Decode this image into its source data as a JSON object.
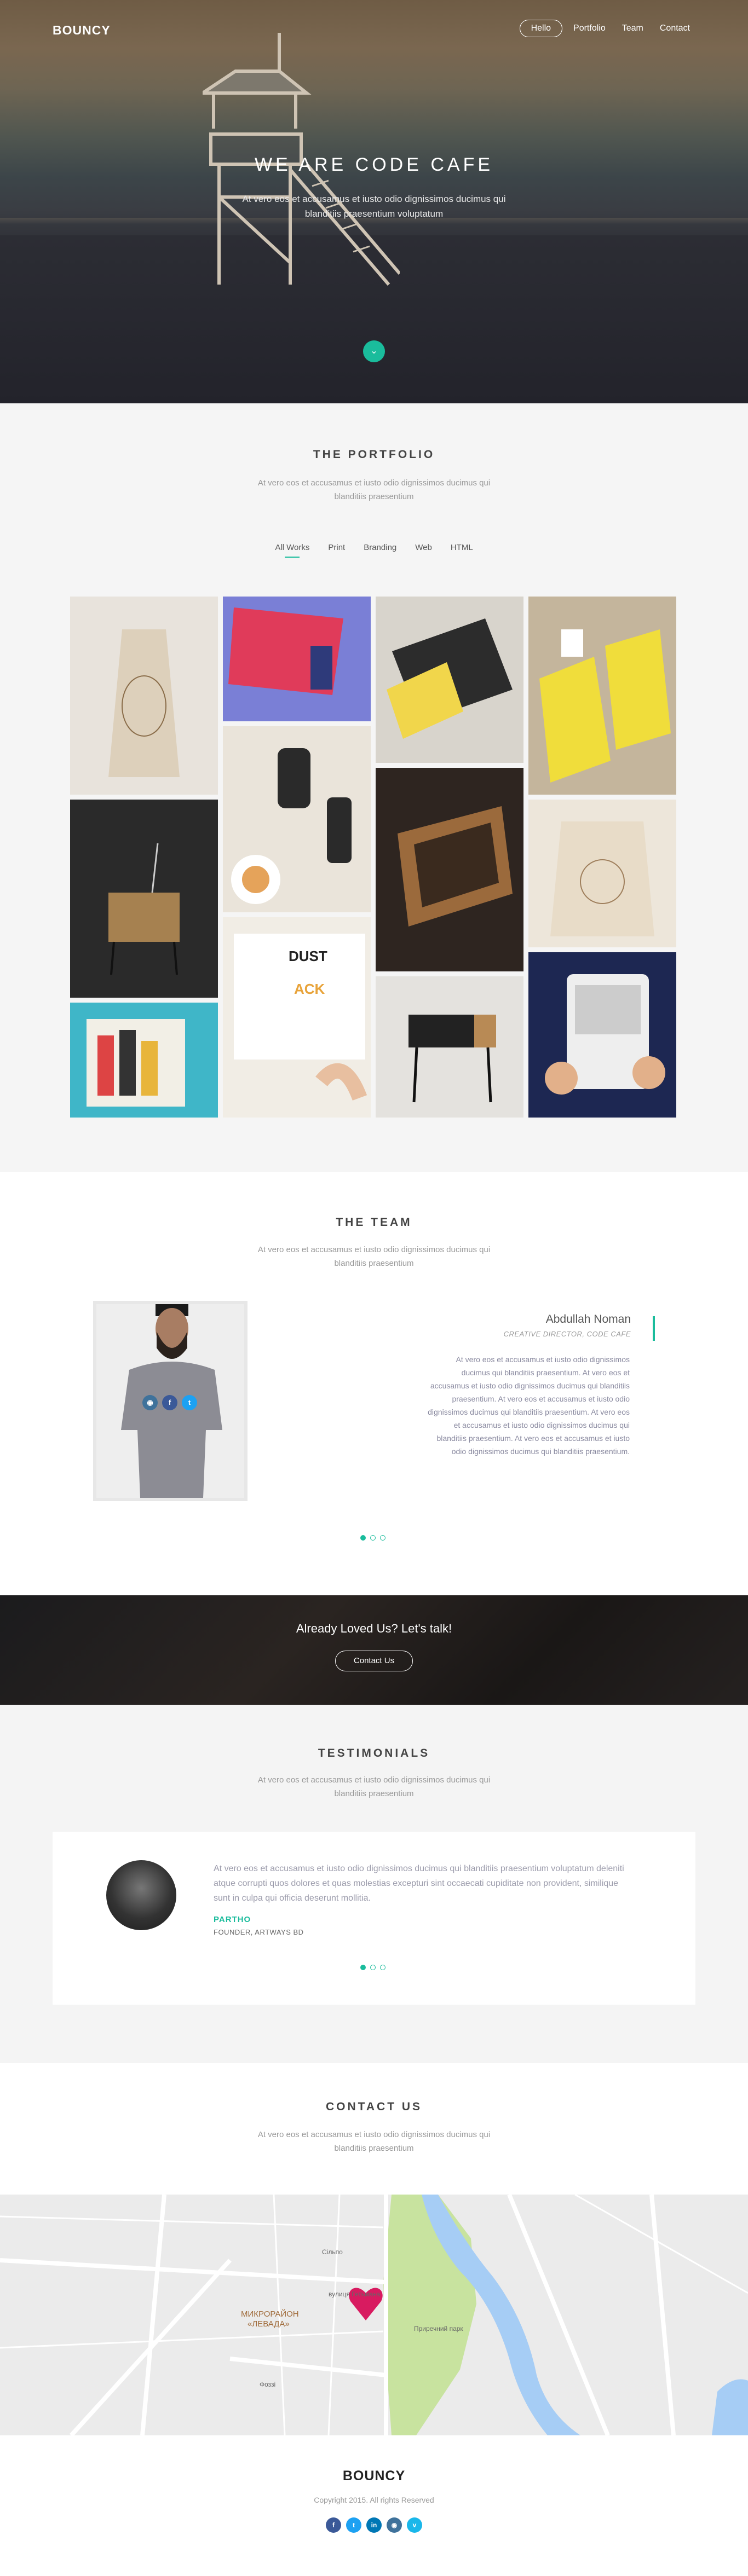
{
  "header": {
    "brand": "BOUNCY",
    "nav": [
      "Hello",
      "Portfolio",
      "Team",
      "Contact"
    ]
  },
  "hero": {
    "title": "WE ARE CODE CAFE",
    "subtitle": "At vero eos et accusamus et iusto odio dignissimos ducimus qui blanditiis praesentium voluptatum",
    "down_icon": "chevron-down-icon"
  },
  "portfolio": {
    "title": "THE PORTFOLIO",
    "subtitle": "At vero eos et accusamus et iusto odio dignissimos ducimus qui blanditiis praesentium",
    "filters": [
      "All Works",
      "Print",
      "Branding",
      "Web",
      "HTML"
    ],
    "active_filter": "All Works"
  },
  "team": {
    "title": "THE TEAM",
    "subtitle": "At vero eos et accusamus et iusto odio dignissimos ducimus qui blanditiis praesentium",
    "member_name": "Abdullah Noman",
    "member_role": "CREATIVE DIRECTOR, CODE CAFE",
    "member_bio": "At vero eos et accusamus et iusto odio dignissimos ducimus qui blanditiis praesentium. At vero eos et accusamus et iusto odio dignissimos ducimus qui blanditiis praesentium. At vero eos et accusamus et iusto odio dignissimos ducimus qui blanditiis praesentium. At vero eos et accusamus et iusto odio dignissimos ducimus qui blanditiis praesentium. At vero eos et accusamus et iusto odio dignissimos ducimus qui blanditiis praesentium.",
    "social": [
      "instagram-icon",
      "facebook-icon",
      "twitter-icon"
    ]
  },
  "cta": {
    "title": "Already Loved Us? Let's talk!",
    "button": "Contact Us"
  },
  "testimonials": {
    "title": "TESTIMONIALS",
    "subtitle": "At vero eos et accusamus et iusto odio dignissimos ducimus qui blanditiis praesentium",
    "quote": "At vero eos et accusamus et iusto odio dignissimos ducimus qui blanditiis praesentium voluptatum deleniti atque corrupti quos dolores et quas molestias excepturi sint occaecati cupiditate non provident, similique sunt in culpa qui officia deserunt mollitia.",
    "name": "PARTHO",
    "role": "FOUNDER, ARTWAYS BD"
  },
  "contact": {
    "title": "CONTACT US",
    "subtitle": "At vero eos et accusamus et iusto odio dignissimos ducimus qui blanditiis praesentium"
  },
  "map": {
    "district": "МИКРОРАЙОН",
    "district_sub": "«ЛЕВАДА»",
    "labels": [
      "Сільпо",
      "Приречний парк",
      "Фоззі",
      "вулиця Гетьмана"
    ]
  },
  "footer": {
    "brand": "BOUNCY",
    "copyright": "Copyright 2015. All rights Reserved",
    "social": [
      "facebook-icon",
      "twitter-icon",
      "linkedin-icon",
      "instagram-icon",
      "vimeo-icon"
    ]
  },
  "colors": {
    "accent": "#1abc9c"
  }
}
